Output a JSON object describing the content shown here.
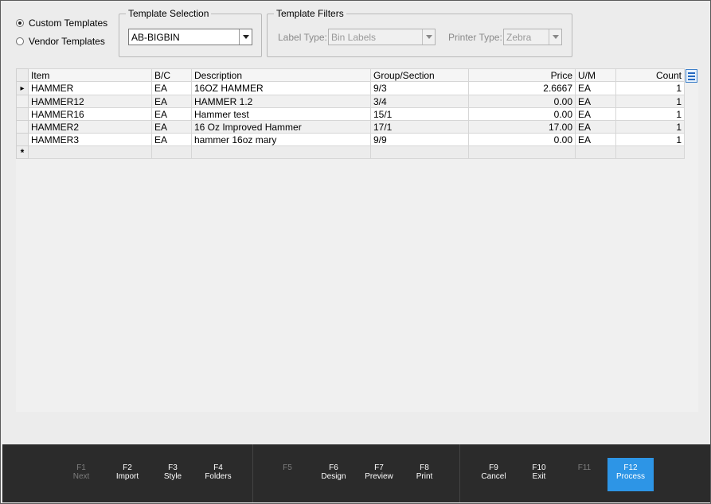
{
  "template_type": {
    "options": [
      {
        "label": "Custom Templates",
        "checked": true
      },
      {
        "label": "Vendor Templates",
        "checked": false
      }
    ]
  },
  "template_selection": {
    "legend": "Template Selection",
    "value": "AB-BIGBIN"
  },
  "template_filters": {
    "legend": "Template Filters",
    "label_type_label": "Label Type:",
    "label_type_value": "Bin Labels",
    "printer_type_label": "Printer Type:",
    "printer_type_value": "Zebra"
  },
  "grid": {
    "columns": [
      "Item",
      "B/C",
      "Description",
      "Group/Section",
      "Price",
      "U/M",
      "Count"
    ],
    "rows": [
      {
        "item": "HAMMER",
        "bc": "EA",
        "description": "16OZ HAMMER",
        "group": "9/3",
        "price": "2.6667",
        "um": "EA",
        "count": "1"
      },
      {
        "item": "HAMMER12",
        "bc": "EA",
        "description": "HAMMER 1.2",
        "group": "3/4",
        "price": "0.00",
        "um": "EA",
        "count": "1"
      },
      {
        "item": "HAMMER16",
        "bc": "EA",
        "description": "Hammer test",
        "group": "15/1",
        "price": "0.00",
        "um": "EA",
        "count": "1"
      },
      {
        "item": "HAMMER2",
        "bc": "EA",
        "description": "16 Oz Improved Hammer",
        "group": "17/1",
        "price": "17.00",
        "um": "EA",
        "count": "1"
      },
      {
        "item": "HAMMER3",
        "bc": "EA",
        "description": "hammer 16oz mary",
        "group": "9/9",
        "price": "0.00",
        "um": "EA",
        "count": "1"
      }
    ],
    "current_row_marker": "▸",
    "new_row_marker": "*"
  },
  "function_keys": [
    {
      "key": "F1",
      "label": "Next",
      "enabled": false
    },
    {
      "key": "F2",
      "label": "Import",
      "enabled": true
    },
    {
      "key": "F3",
      "label": "Style",
      "enabled": true
    },
    {
      "key": "F4",
      "label": "Folders",
      "enabled": true
    },
    {
      "key": "F5",
      "label": "",
      "enabled": false
    },
    {
      "key": "F6",
      "label": "Design",
      "enabled": true
    },
    {
      "key": "F7",
      "label": "Preview",
      "enabled": true
    },
    {
      "key": "F8",
      "label": "Print",
      "enabled": true
    },
    {
      "key": "F9",
      "label": "Cancel",
      "enabled": true
    },
    {
      "key": "F10",
      "label": "Exit",
      "enabled": true
    },
    {
      "key": "F11",
      "label": "",
      "enabled": false
    },
    {
      "key": "F12",
      "label": "Process",
      "enabled": true,
      "active": true
    }
  ],
  "colors": {
    "accent": "#2d95e6",
    "footer_bg": "#2b2b2b"
  }
}
